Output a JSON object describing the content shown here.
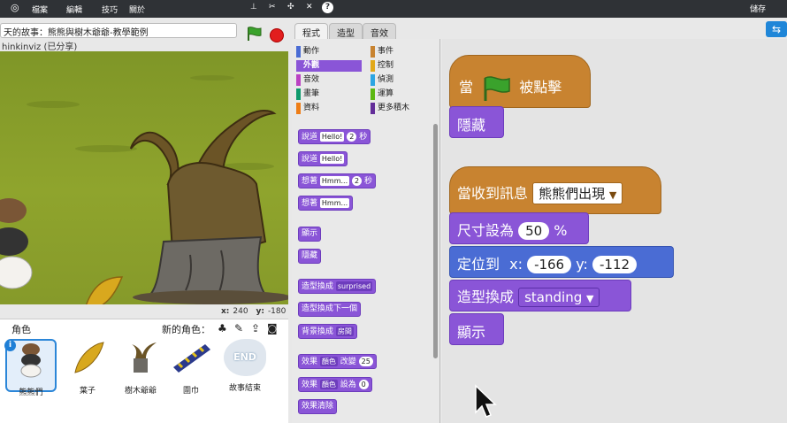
{
  "menu": {
    "file": "檔案",
    "edit": "編輯",
    "tips": "技巧",
    "about": "關於",
    "save": "儲存"
  },
  "project": {
    "title": "天的故事：熊熊與樹木爺爺-教學範例",
    "author": "hinkinviz (已分享)"
  },
  "stage": {
    "x_label": "x:",
    "x_value": "240",
    "y_label": "y:",
    "y_value": "-180"
  },
  "sprites": {
    "label": "角色",
    "new_label": "新的角色：",
    "items": [
      {
        "name": "熊熊們"
      },
      {
        "name": "葉子"
      },
      {
        "name": "樹木爺爺"
      },
      {
        "name": "圍巾"
      },
      {
        "name": "故事結束",
        "thumb_text": "END"
      }
    ]
  },
  "tabs": {
    "scripts": "程式",
    "costumes": "造型",
    "sounds": "音效"
  },
  "categories": [
    {
      "label": "動作",
      "color": "#4a6cd4"
    },
    {
      "label": "事件",
      "color": "#c88330"
    },
    {
      "label": "外觀",
      "color": "#8a55d7"
    },
    {
      "label": "控制",
      "color": "#e1a91a"
    },
    {
      "label": "音效",
      "color": "#bb42c3"
    },
    {
      "label": "偵測",
      "color": "#2ca5e2"
    },
    {
      "label": "畫筆",
      "color": "#0e9a6c"
    },
    {
      "label": "運算",
      "color": "#5cb712"
    },
    {
      "label": "資料",
      "color": "#ee7d16"
    },
    {
      "label": "更多積木",
      "color": "#632d99"
    }
  ],
  "palette": {
    "say_secs": {
      "label": "說道",
      "text": "Hello!",
      "num": "2",
      "unit": "秒"
    },
    "say": {
      "label": "說道",
      "text": "Hello!"
    },
    "think_secs": {
      "label": "想著",
      "text": "Hmm...",
      "num": "2",
      "unit": "秒"
    },
    "think": {
      "label": "想著",
      "text": "Hmm..."
    },
    "show": "顯示",
    "hide": "隱藏",
    "switch_costume": {
      "label": "造型換成",
      "value": "surprised"
    },
    "next_costume": "造型換成下一個",
    "switch_backdrop": {
      "label": "背景換成",
      "value": "房間"
    },
    "change_effect": {
      "label": "效果",
      "effect": "顏色",
      "verb": "改變",
      "num": "25"
    },
    "set_effect": {
      "label": "效果",
      "effect": "顏色",
      "verb": "設為",
      "num": "0"
    },
    "clear_effects": "效果清除"
  },
  "scripts": {
    "flag_hat": {
      "when": "當",
      "clicked": "被點擊"
    },
    "hide1": "隱藏",
    "receive_hat": {
      "label": "當收到訊息",
      "message": "熊熊們出現"
    },
    "set_size": {
      "label": "尺寸設為",
      "value": "50",
      "unit": "%"
    },
    "goto": {
      "label": "定位到",
      "x_label": "x:",
      "x_value": "-166",
      "y_label": "y:",
      "y_value": "-112"
    },
    "switch_costume": {
      "label": "造型換成",
      "value": "standing"
    },
    "show": "顯示"
  }
}
